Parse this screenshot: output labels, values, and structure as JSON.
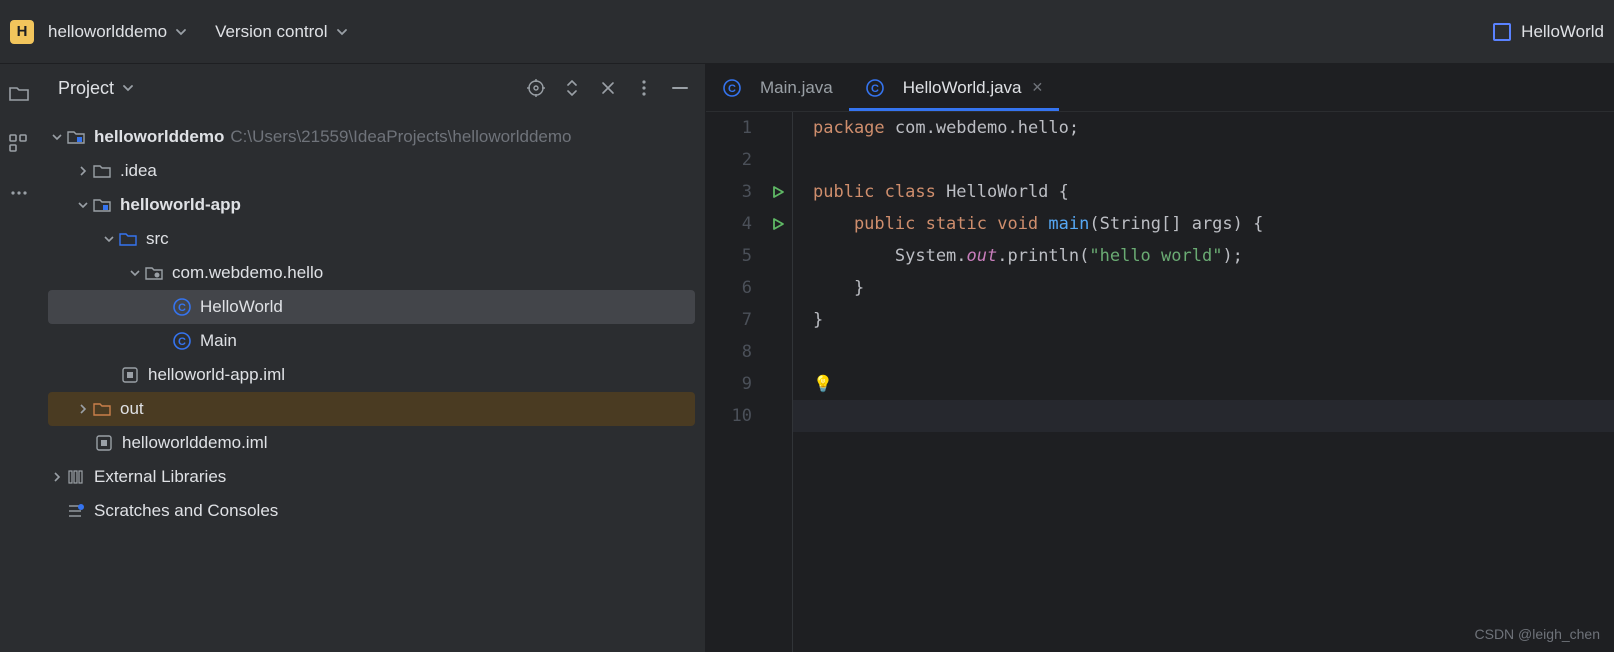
{
  "topbar": {
    "badge": "H",
    "project_name": "helloworlddemo",
    "version_control": "Version control",
    "run_config": "HelloWorld"
  },
  "sidebar": {
    "title": "Project",
    "tree": {
      "root": {
        "label": "helloworlddemo",
        "path": "C:\\Users\\21559\\IdeaProjects\\helloworlddemo"
      },
      "idea": ".idea",
      "app": "helloworld-app",
      "src": "src",
      "pkg": "com.webdemo.hello",
      "hello": "HelloWorld",
      "main_cls": "Main",
      "app_iml": "helloworld-app.iml",
      "out": "out",
      "root_iml": "helloworlddemo.iml",
      "ext_lib": "External Libraries",
      "scratches": "Scratches and Consoles"
    }
  },
  "tabs": {
    "main": "Main.java",
    "hello": "HelloWorld.java"
  },
  "editor": {
    "lines": [
      "1",
      "2",
      "3",
      "4",
      "5",
      "6",
      "7",
      "8",
      "9",
      "10"
    ],
    "code": {
      "l1_a": "package",
      "l1_b": " com.webdemo.hello;",
      "l3_a": "public class",
      "l3_b": " HelloWorld {",
      "l4_a": "    public static void",
      "l4_b": " main",
      "l4_c": "(String[] args) {",
      "l5_a": "        System.",
      "l5_b": "out",
      "l5_c": ".println(",
      "l5_d": "\"hello world\"",
      "l5_e": ");",
      "l6": "    }",
      "l7": "}"
    }
  },
  "watermark": "CSDN @leigh_chen"
}
